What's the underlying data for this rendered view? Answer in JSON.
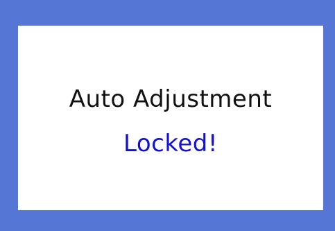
{
  "osd": {
    "title": "Auto Adjustment",
    "status": "Locked!"
  },
  "colors": {
    "frame": "#5676d6",
    "panel": "#ffffff",
    "title_text": "#111111",
    "status_text": "#1010d8"
  }
}
